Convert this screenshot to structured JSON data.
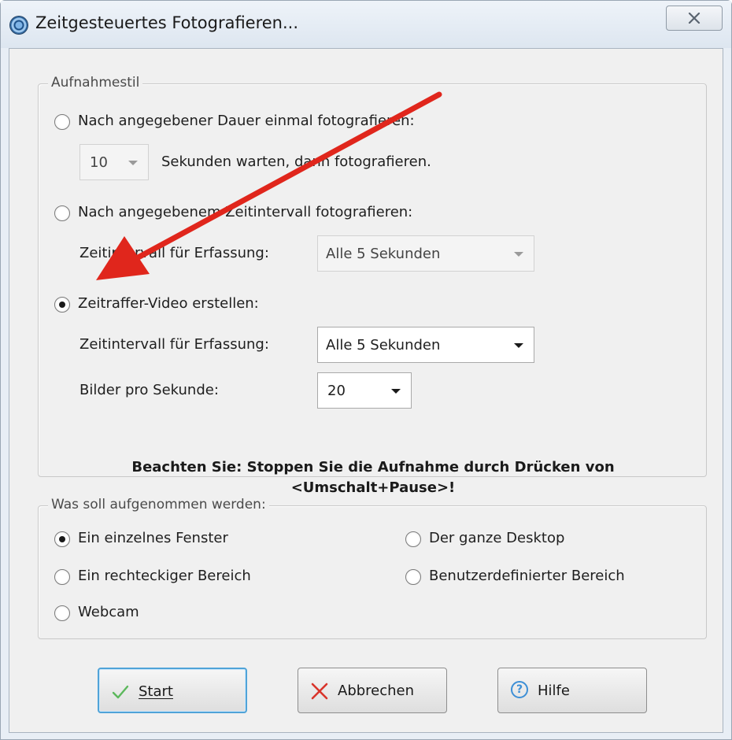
{
  "window": {
    "title": "Zeitgesteuertes Fotografieren...",
    "close_icon": "close-icon"
  },
  "aufnahmestil": {
    "legend": "Aufnahmestil",
    "option_once": {
      "label": "Nach angegebener Dauer einmal fotografieren:",
      "checked": false
    },
    "delay": {
      "value": "10",
      "suffix": "Sekunden warten, dann fotografieren."
    },
    "option_interval": {
      "label": "Nach angegebenem Zeitintervall fotografieren:",
      "checked": false
    },
    "interval": {
      "label": "Zeitintervall für Erfassung:",
      "value": "Alle 5 Sekunden",
      "enabled": false
    },
    "option_timelapse": {
      "label": "Zeitraffer-Video erstellen:",
      "checked": true
    },
    "timelapse_interval": {
      "label": "Zeitintervall für Erfassung:",
      "value": "Alle 5 Sekunden"
    },
    "fps": {
      "label": "Bilder pro Sekunde:",
      "value": "20"
    },
    "notice_line1": "Beachten Sie: Stoppen Sie die Aufnahme durch Drücken von",
    "notice_line2": "<Umschalt+Pause>!"
  },
  "target": {
    "legend": "Was soll aufgenommen werden:",
    "options": [
      {
        "label": "Ein einzelnes Fenster",
        "checked": true
      },
      {
        "label": "Der ganze Desktop",
        "checked": false
      },
      {
        "label": "Ein rechteckiger Bereich",
        "checked": false
      },
      {
        "label": "Benutzerdefinierter Bereich",
        "checked": false
      },
      {
        "label": "Webcam",
        "checked": false
      }
    ]
  },
  "buttons": {
    "start": {
      "label": "Start",
      "icon": "checkmark-icon"
    },
    "cancel": {
      "label": "Abbrechen",
      "icon": "x-icon"
    },
    "help": {
      "label": "Hilfe",
      "icon": "question-icon",
      "glyph": "?"
    }
  },
  "annotation": {
    "type": "arrow",
    "color": "#e0261c"
  }
}
